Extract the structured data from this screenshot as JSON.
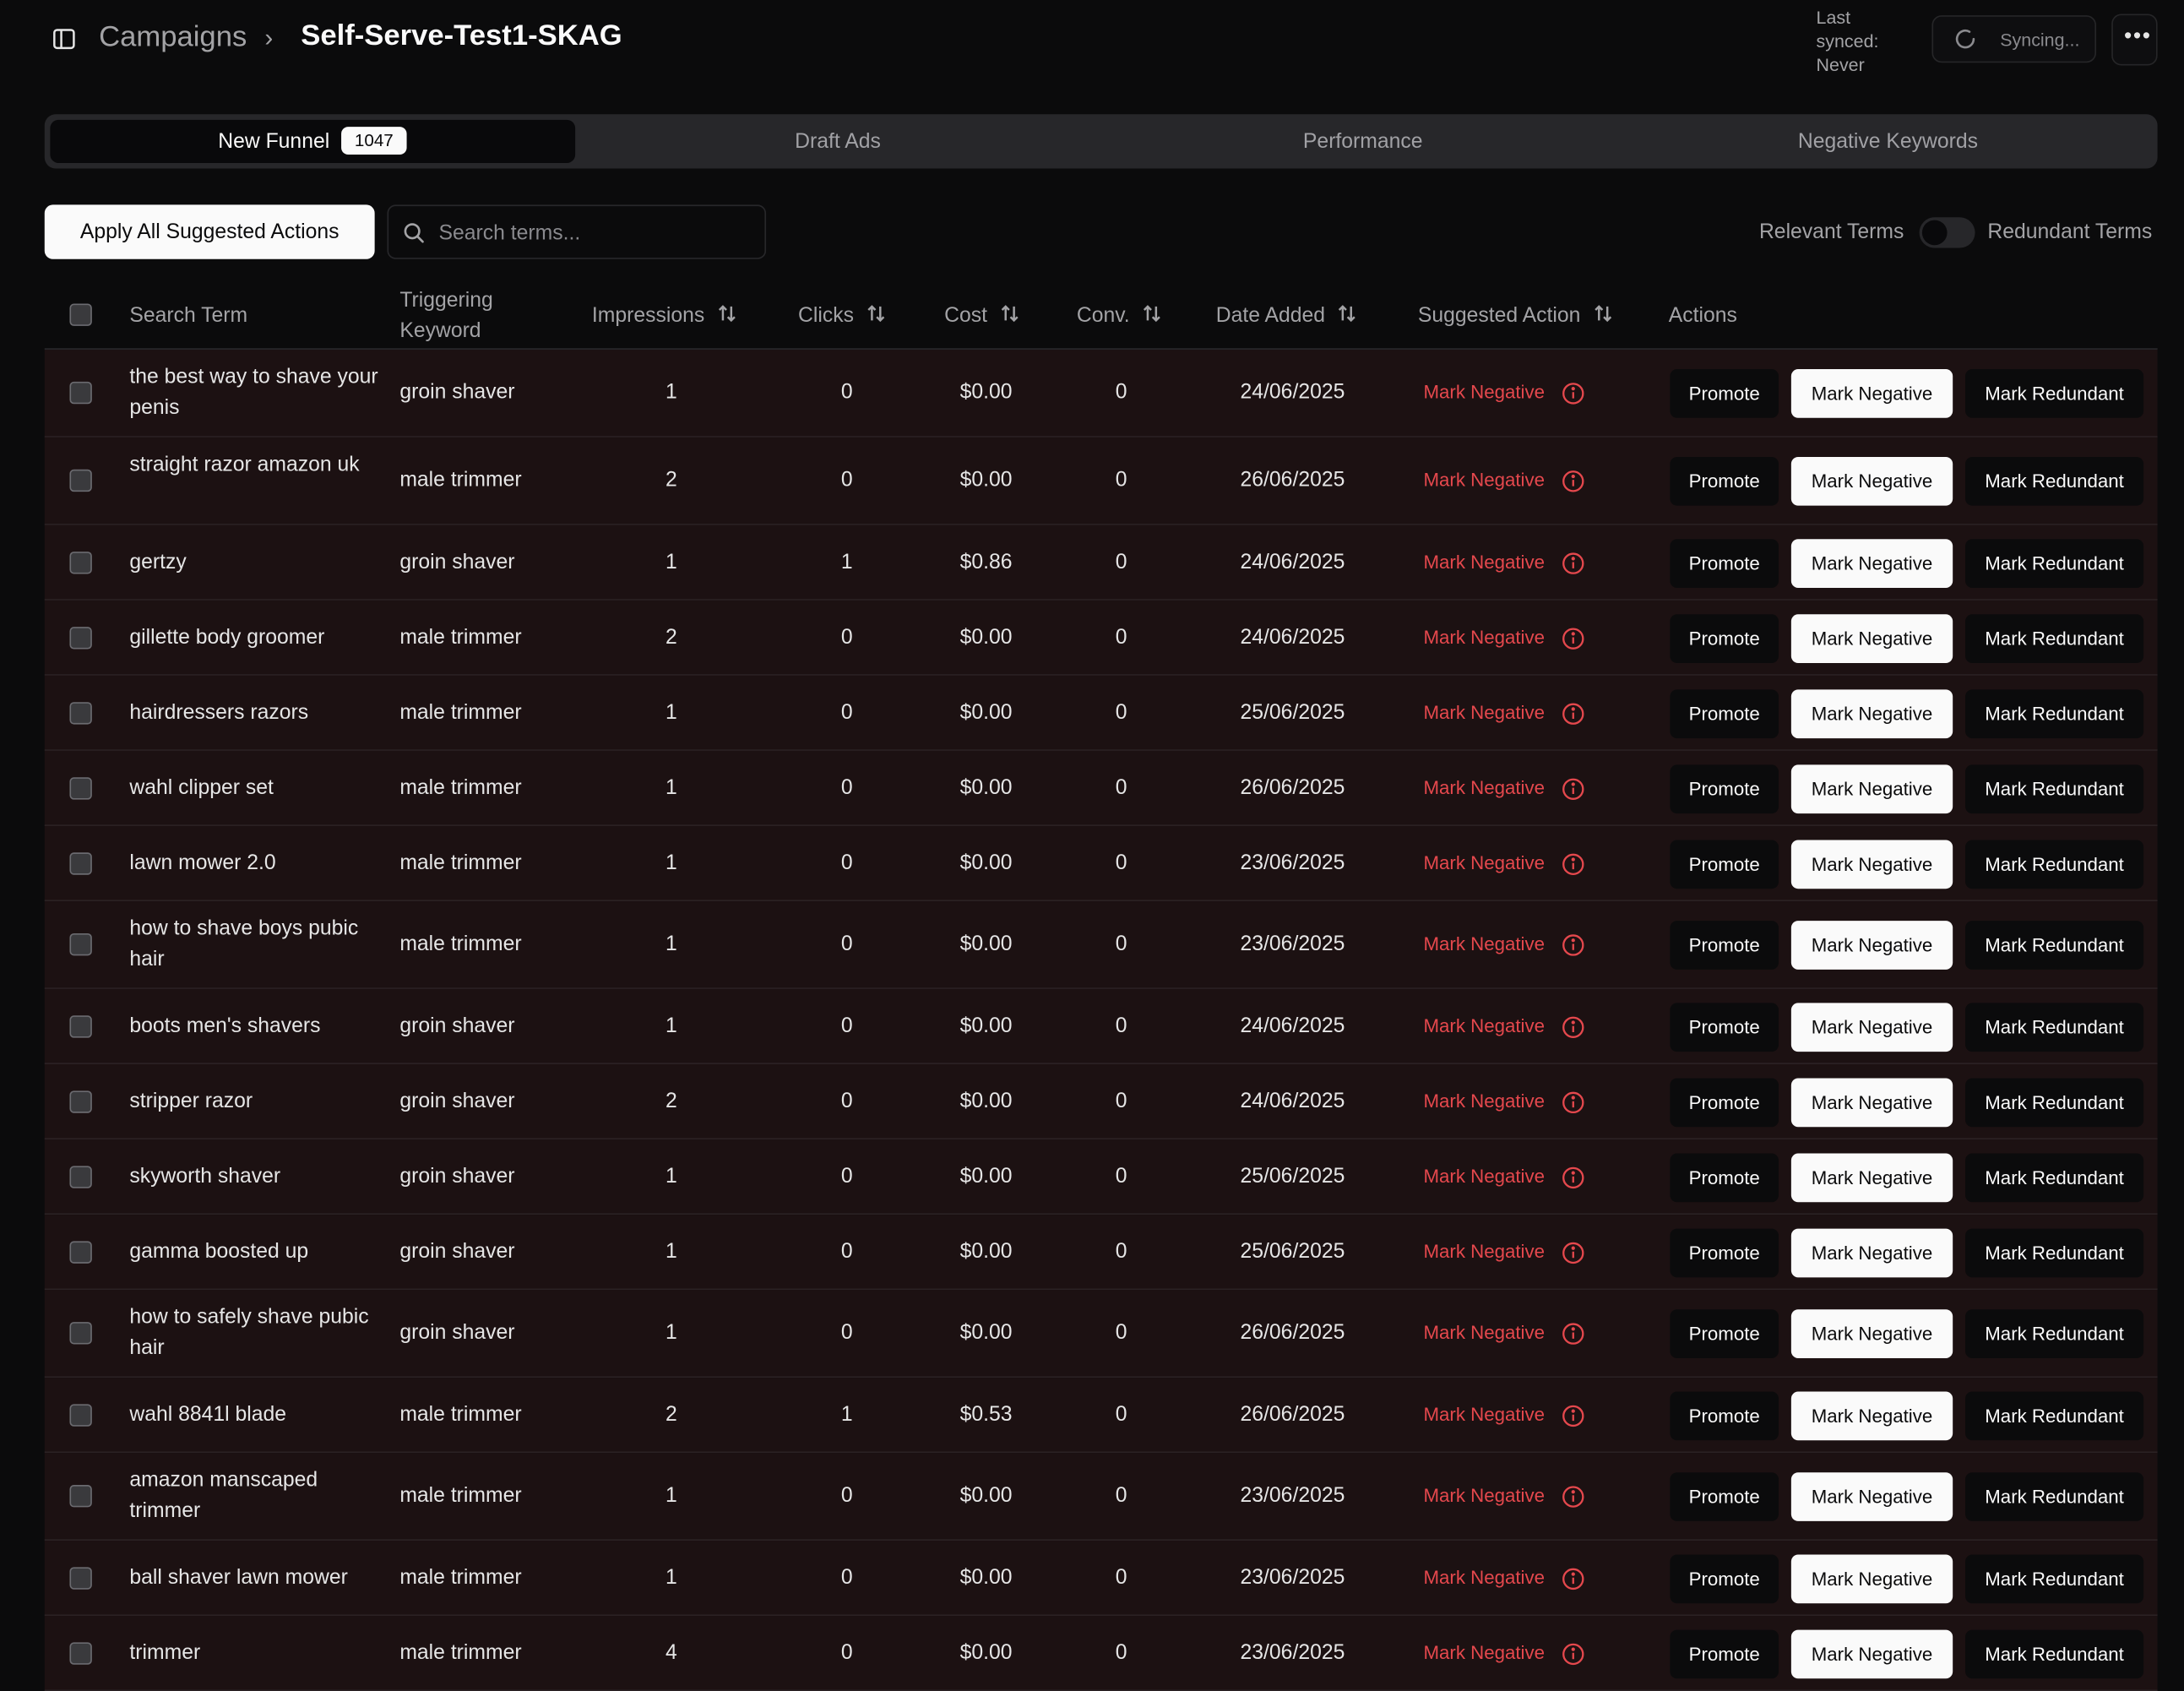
{
  "breadcrumb": {
    "parent": "Campaigns",
    "current": "Self-Serve-Test1-SKAG"
  },
  "sync": {
    "last_synced": "Last synced: Never",
    "status": "Syncing..."
  },
  "tabs": [
    {
      "label": "New Funnel",
      "badge": "1047",
      "active": true
    },
    {
      "label": "Draft Ads"
    },
    {
      "label": "Performance"
    },
    {
      "label": "Negative Keywords"
    }
  ],
  "toolbar": {
    "apply_label": "Apply All Suggested Actions",
    "search_placeholder": "Search terms...",
    "toggle_left": "Relevant Terms",
    "toggle_right": "Redundant Terms",
    "toggle_on": false
  },
  "table": {
    "headers": {
      "search_term": "Search Term",
      "keyword": "Triggering Keyword",
      "impressions": "Impressions",
      "clicks": "Clicks",
      "cost": "Cost",
      "conv": "Conv.",
      "date_added": "Date Added",
      "suggested": "Suggested Action",
      "actions": "Actions"
    },
    "button_labels": {
      "promote": "Promote",
      "negative": "Mark Negative",
      "redundant": "Mark Redundant"
    },
    "rows": [
      {
        "term": "the best way to shave your penis",
        "keyword": "groin shaver",
        "impressions": "1",
        "clicks": "0",
        "cost": "$0.00",
        "conv": "0",
        "date": "24/06/2025",
        "suggested": "Mark Negative"
      },
      {
        "term": "straight razor amazon uk",
        "keyword": "male trimmer",
        "impressions": "2",
        "clicks": "0",
        "cost": "$0.00",
        "conv": "0",
        "date": "26/06/2025",
        "suggested": "Mark Negative"
      },
      {
        "term": "gertzy",
        "keyword": "groin shaver",
        "impressions": "1",
        "clicks": "1",
        "cost": "$0.86",
        "conv": "0",
        "date": "24/06/2025",
        "suggested": "Mark Negative"
      },
      {
        "term": "gillette body groomer",
        "keyword": "male trimmer",
        "impressions": "2",
        "clicks": "0",
        "cost": "$0.00",
        "conv": "0",
        "date": "24/06/2025",
        "suggested": "Mark Negative"
      },
      {
        "term": "hairdressers razors",
        "keyword": "male trimmer",
        "impressions": "1",
        "clicks": "0",
        "cost": "$0.00",
        "conv": "0",
        "date": "25/06/2025",
        "suggested": "Mark Negative"
      },
      {
        "term": "wahl clipper set",
        "keyword": "male trimmer",
        "impressions": "1",
        "clicks": "0",
        "cost": "$0.00",
        "conv": "0",
        "date": "26/06/2025",
        "suggested": "Mark Negative"
      },
      {
        "term": "lawn mower 2.0",
        "keyword": "male trimmer",
        "impressions": "1",
        "clicks": "0",
        "cost": "$0.00",
        "conv": "0",
        "date": "23/06/2025",
        "suggested": "Mark Negative"
      },
      {
        "term": "how to shave boys pubic hair",
        "keyword": "male trimmer",
        "impressions": "1",
        "clicks": "0",
        "cost": "$0.00",
        "conv": "0",
        "date": "23/06/2025",
        "suggested": "Mark Negative"
      },
      {
        "term": "boots men's shavers",
        "keyword": "groin shaver",
        "impressions": "1",
        "clicks": "0",
        "cost": "$0.00",
        "conv": "0",
        "date": "24/06/2025",
        "suggested": "Mark Negative"
      },
      {
        "term": "stripper razor",
        "keyword": "groin shaver",
        "impressions": "2",
        "clicks": "0",
        "cost": "$0.00",
        "conv": "0",
        "date": "24/06/2025",
        "suggested": "Mark Negative"
      },
      {
        "term": "skyworth shaver",
        "keyword": "groin shaver",
        "impressions": "1",
        "clicks": "0",
        "cost": "$0.00",
        "conv": "0",
        "date": "25/06/2025",
        "suggested": "Mark Negative"
      },
      {
        "term": "gamma boosted up",
        "keyword": "groin shaver",
        "impressions": "1",
        "clicks": "0",
        "cost": "$0.00",
        "conv": "0",
        "date": "25/06/2025",
        "suggested": "Mark Negative"
      },
      {
        "term": "how to safely shave pubic hair",
        "keyword": "groin shaver",
        "impressions": "1",
        "clicks": "0",
        "cost": "$0.00",
        "conv": "0",
        "date": "26/06/2025",
        "suggested": "Mark Negative"
      },
      {
        "term": "wahl 8841l blade",
        "keyword": "male trimmer",
        "impressions": "2",
        "clicks": "1",
        "cost": "$0.53",
        "conv": "0",
        "date": "26/06/2025",
        "suggested": "Mark Negative"
      },
      {
        "term": "amazon manscaped trimmer",
        "keyword": "male trimmer",
        "impressions": "1",
        "clicks": "0",
        "cost": "$0.00",
        "conv": "0",
        "date": "23/06/2025",
        "suggested": "Mark Negative"
      },
      {
        "term": "ball shaver lawn mower",
        "keyword": "male trimmer",
        "impressions": "1",
        "clicks": "0",
        "cost": "$0.00",
        "conv": "0",
        "date": "23/06/2025",
        "suggested": "Mark Negative"
      },
      {
        "term": "trimmer",
        "keyword": "male trimmer",
        "impressions": "4",
        "clicks": "0",
        "cost": "$0.00",
        "conv": "0",
        "date": "23/06/2025",
        "suggested": "Mark Negative"
      }
    ]
  },
  "colors": {
    "accent_negative": "#e5484d",
    "row_bg": "#1c1112",
    "page_bg": "#0b0b0c"
  }
}
